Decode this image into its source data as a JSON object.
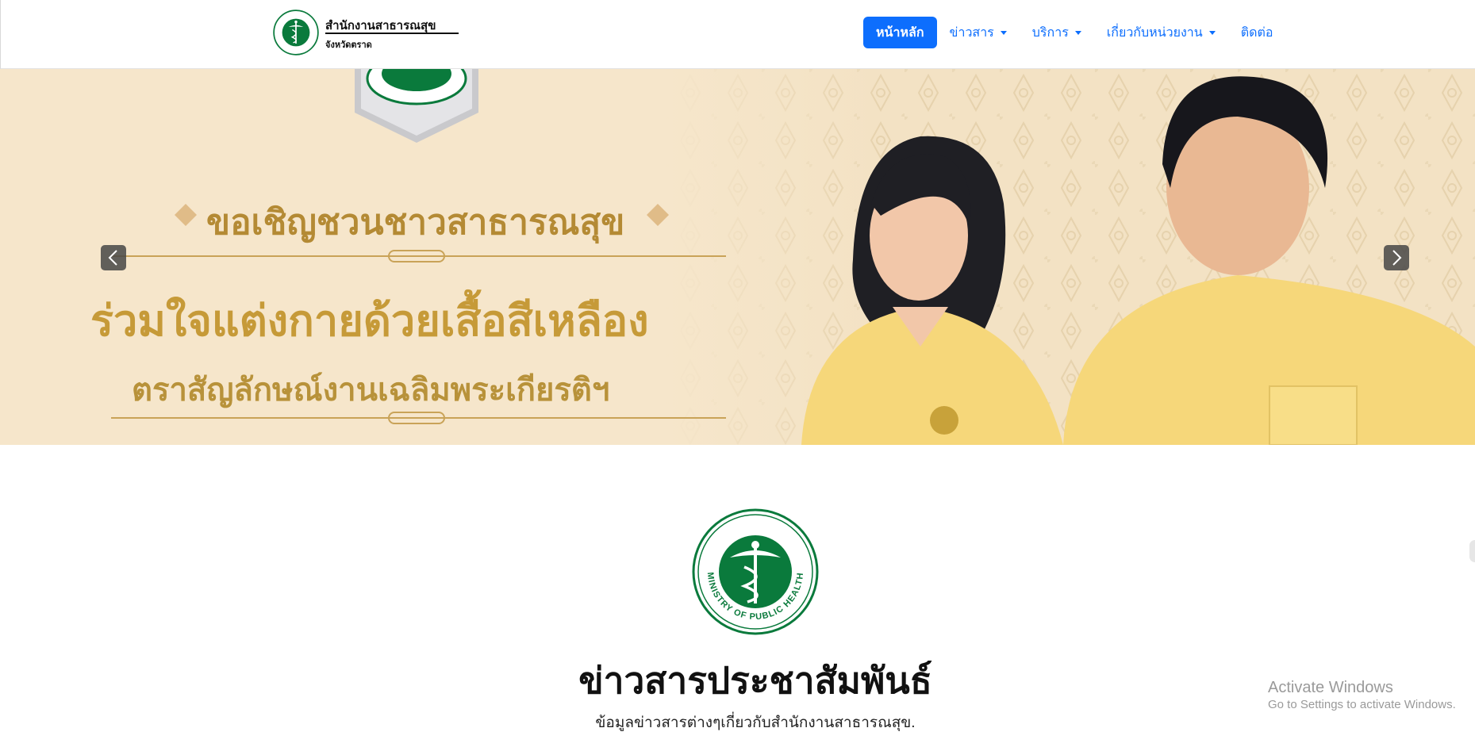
{
  "navbar": {
    "brand": {
      "title": "สำนักงานสาธารณสุข",
      "subtitle": "จังหวัดตราด",
      "logo_icon": "ministry-of-public-health-seal",
      "logo_ring_text": "MINISTRY OF PUBLIC HEALTH"
    },
    "menu": [
      {
        "label": "หน้าหลัก",
        "active": true,
        "dropdown": false
      },
      {
        "label": "ข่าวสาร",
        "active": false,
        "dropdown": true
      },
      {
        "label": "บริการ",
        "active": false,
        "dropdown": true
      },
      {
        "label": "เกี่ยวกับหน่วยงาน",
        "active": false,
        "dropdown": true
      },
      {
        "label": "ติดต่อ",
        "active": false,
        "dropdown": false
      }
    ]
  },
  "hero": {
    "line1": "ขอเชิญชวนชาวสาธารณสุข",
    "line2": "ร่วมใจแต่งกายด้วยเสื้อสีเหลือง",
    "line3": "ตราสัญลักษณ์งานเฉลิมพระเกียรติฯ",
    "prev_icon": "chevron-left-icon",
    "next_icon": "chevron-right-icon"
  },
  "news_section": {
    "logo_icon": "ministry-of-public-health-seal",
    "logo_ring_text": "MINISTRY OF PUBLIC HEALTH",
    "title": "ข่าวสารประชาสัมพันธ์",
    "subtitle": "ข้อมูลข่าวสารต่างๆเกี่ยวกับสำนักงานสาธารณสุข."
  },
  "watermark": {
    "title": "Activate Windows",
    "subtitle": "Go to Settings to activate Windows."
  },
  "colors": {
    "primary": "#0d6efd",
    "seal_green": "#0a7a3c",
    "banner_gold": "#c69a38",
    "banner_bg": "#f6e6cb"
  }
}
